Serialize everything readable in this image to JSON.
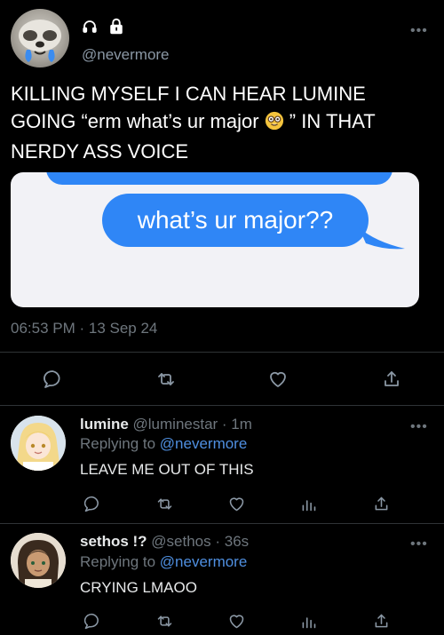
{
  "main_tweet": {
    "handle": "@nevermore",
    "text_line1": "KILLING MYSELF I CAN HEAR LUMINE",
    "text_line2a": "GOING “erm what’s ur major",
    "text_line2b": " ” IN THAT",
    "text_line3": "NERDY ASS VOICE",
    "image_bubble_text": "what’s ur major??",
    "timestamp": "06:53 PM · 13 Sep 24",
    "more": "•••"
  },
  "replies": [
    {
      "name": "lumine",
      "meta": " @luminestar · 1m",
      "replying_prefix": "Replying to ",
      "replying_to": "@nevermore",
      "text": "LEAVE ME OUT OF THIS",
      "more": "•••"
    },
    {
      "name": "sethos !?",
      "meta": " @sethos · 36s",
      "replying_prefix": "Replying to ",
      "replying_to": "@nevermore",
      "text": "CRYING LMAOO",
      "more": "•••"
    }
  ],
  "icons": [
    "headphones-icon",
    "lock-icon",
    "reply-icon",
    "retweet-icon",
    "like-icon",
    "share-icon",
    "analytics-icon",
    "nerd-emoji-icon"
  ],
  "colors": {
    "background": "#000000",
    "bubble_blue": "#2f86f6",
    "mention_blue": "#4f8fe0",
    "muted": "#6e767d"
  }
}
